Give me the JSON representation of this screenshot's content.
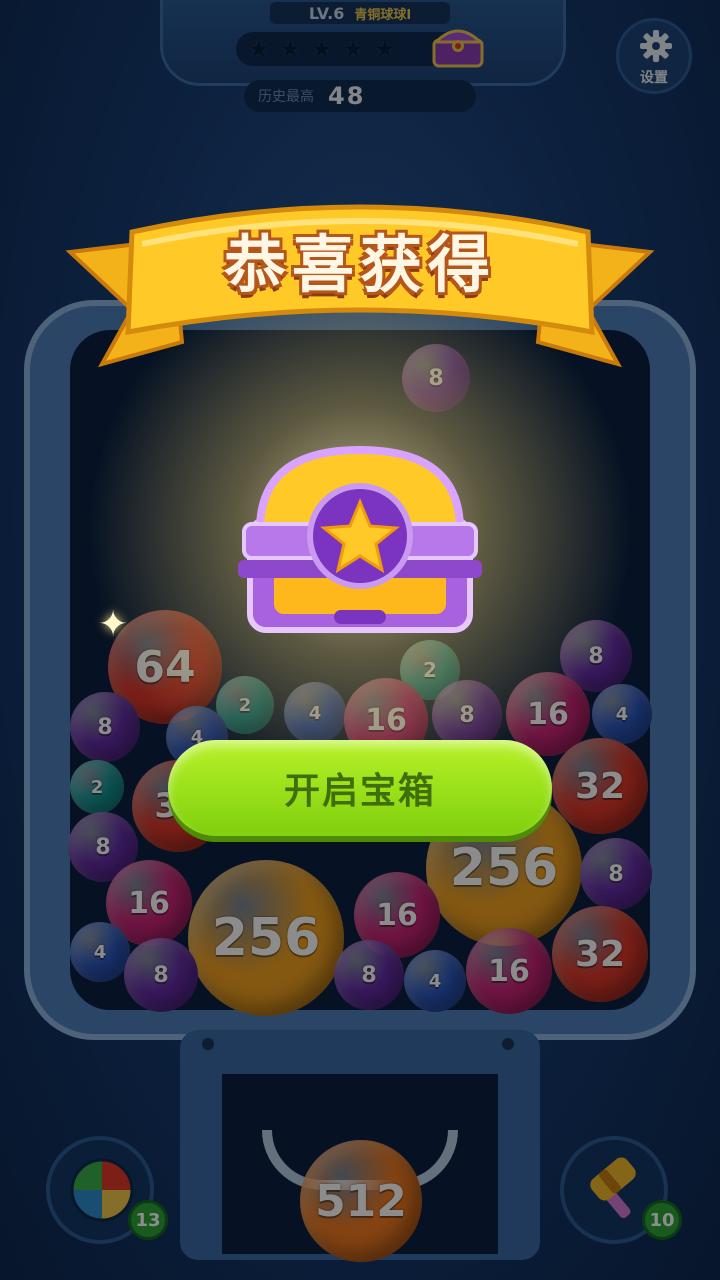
{
  "hud": {
    "level": "LV.6",
    "rank": "青铜球球I",
    "stars_filled": 0,
    "stars_total": 5,
    "best_label": "历史最高",
    "best_value": "48"
  },
  "settings": {
    "label": "设置",
    "icon": "gear-icon"
  },
  "board": {
    "balls": [
      {
        "value": "8",
        "color": "#6a2fb0"
      },
      {
        "value": "64",
        "color": "#e0392b"
      },
      {
        "value": "2",
        "color": "#1aa8a8"
      },
      {
        "value": "8",
        "color": "#6a2fb0"
      },
      {
        "value": "8",
        "color": "#6a2fb0"
      },
      {
        "value": "2",
        "color": "#1aa8a8"
      },
      {
        "value": "4",
        "color": "#2f5fd0"
      },
      {
        "value": "2",
        "color": "#1aa8a8"
      },
      {
        "value": "4",
        "color": "#2f5fd0"
      },
      {
        "value": "16",
        "color": "#d0267a"
      },
      {
        "value": "8",
        "color": "#6a2fb0"
      },
      {
        "value": "16",
        "color": "#d0267a"
      },
      {
        "value": "4",
        "color": "#2f5fd0"
      },
      {
        "value": "32",
        "color": "#e0392b"
      },
      {
        "value": "32",
        "color": "#e0392b"
      },
      {
        "value": "8",
        "color": "#6a2fb0"
      },
      {
        "value": "256",
        "color": "#f0a020"
      },
      {
        "value": "8",
        "color": "#6a2fb0"
      },
      {
        "value": "16",
        "color": "#d0267a"
      },
      {
        "value": "256",
        "color": "#f0a020"
      },
      {
        "value": "16",
        "color": "#d0267a"
      },
      {
        "value": "4",
        "color": "#2f5fd0"
      },
      {
        "value": "8",
        "color": "#6a2fb0"
      },
      {
        "value": "8",
        "color": "#6a2fb0"
      },
      {
        "value": "4",
        "color": "#2f5fd0"
      },
      {
        "value": "16",
        "color": "#d0267a"
      },
      {
        "value": "32",
        "color": "#e0392b"
      }
    ],
    "next_ball": {
      "value": "512",
      "color": "#f07a20"
    }
  },
  "popup": {
    "title": "恭喜获得",
    "reward_icon": "treasure-chest-icon",
    "open_button_label": "开启宝箱"
  },
  "tools": [
    {
      "name": "beach-ball-tool",
      "icon": "beach-ball-icon",
      "count": "13"
    },
    {
      "name": "hammer-tool",
      "icon": "hammer-icon",
      "count": "10"
    }
  ]
}
